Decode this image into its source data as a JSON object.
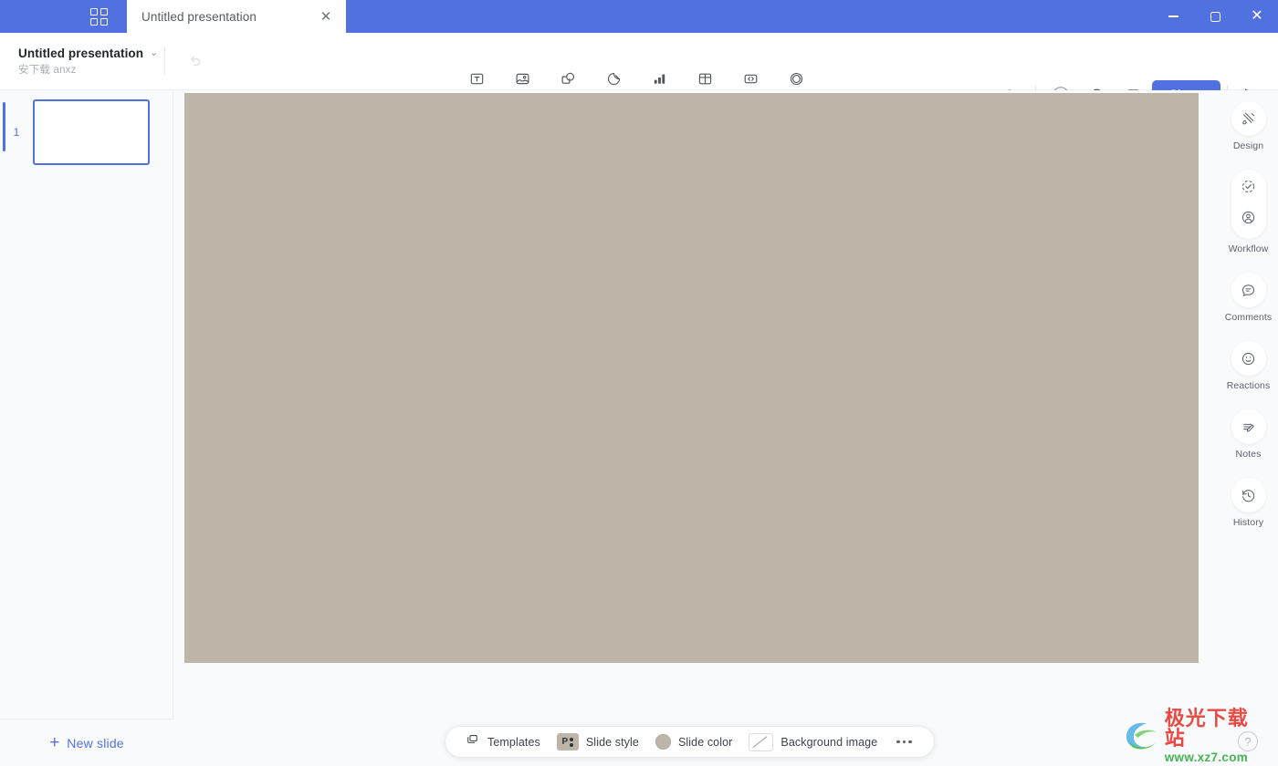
{
  "titlebar": {
    "grid_icon": "apps-grid-icon",
    "tab_title": "Untitled presentation",
    "tab_close_glyph": "✕",
    "window_minimize": "minimize-icon",
    "window_maximize": "maximize-icon",
    "window_close_glyph": "✕"
  },
  "document": {
    "title": "Untitled presentation",
    "caret_glyph": "⌄",
    "subtitle": "安下载 anxz",
    "undo_label": "undo-icon"
  },
  "toolbar": {
    "tools": [
      {
        "label": "Text",
        "icon": "text-box-icon"
      },
      {
        "label": "Media",
        "icon": "media-image-icon"
      },
      {
        "label": "Shape",
        "icon": "shape-icon"
      },
      {
        "label": "Sticker",
        "icon": "sticker-icon"
      },
      {
        "label": "Chart",
        "icon": "bar-chart-icon"
      },
      {
        "label": "Table",
        "icon": "table-grid-icon"
      },
      {
        "label": "Embed",
        "icon": "embed-code-icon"
      },
      {
        "label": "Record",
        "icon": "record-circle-icon"
      }
    ],
    "right_icons": [
      {
        "name": "notifications-bell-icon"
      },
      {
        "name": "search-icon"
      },
      {
        "name": "add-plus-icon"
      },
      {
        "name": "headphones-audio-icon"
      },
      {
        "name": "analytics-bars-icon"
      }
    ],
    "share_label": "Share",
    "present_label": "present-play-icon"
  },
  "slides_panel": {
    "slides": [
      {
        "number": "1",
        "thumb_color": "#bdb5a7"
      }
    ],
    "new_slide_plus": "+",
    "new_slide_label": "New slide"
  },
  "canvas": {
    "slide_color": "#bdb5a7",
    "stage_background": "#f9fafb"
  },
  "bottom_bar": {
    "items": [
      {
        "label": "Templates",
        "icon": "templates-stack-icon"
      },
      {
        "label": "Slide style",
        "icon": "slide-style-chip-icon",
        "chip_letter": "P"
      },
      {
        "label": "Slide color",
        "icon": "slide-color-swatch-icon",
        "swatch": "#bdb5a7"
      },
      {
        "label": "Background image",
        "icon": "background-image-chip-icon"
      }
    ],
    "more_label": "more-options-icon"
  },
  "right_rail": {
    "items": [
      {
        "label": "Design",
        "icon": "design-brush-icon",
        "type": "circle"
      },
      {
        "label": "Workflow",
        "icon": "workflow-check-icon",
        "icon2": "workflow-person-icon",
        "type": "pill"
      },
      {
        "label": "Comments",
        "icon": "comments-bubble-icon",
        "type": "circle"
      },
      {
        "label": "Reactions",
        "icon": "reactions-smiley-icon",
        "type": "circle"
      },
      {
        "label": "Notes",
        "icon": "notes-pencil-icon",
        "type": "circle"
      },
      {
        "label": "History",
        "icon": "history-clock-icon",
        "type": "circle"
      }
    ]
  },
  "help": {
    "glyph": "?",
    "name": "help-question-icon"
  },
  "watermark": {
    "chinese": "极光下载站",
    "url": "www.xz7.com"
  },
  "colors": {
    "accent": "#5271e0",
    "slide": "#bdb5a7",
    "panel_bg": "#f9fafb",
    "watermark_red": "#e8403a",
    "watermark_green": "#3bb24a"
  }
}
